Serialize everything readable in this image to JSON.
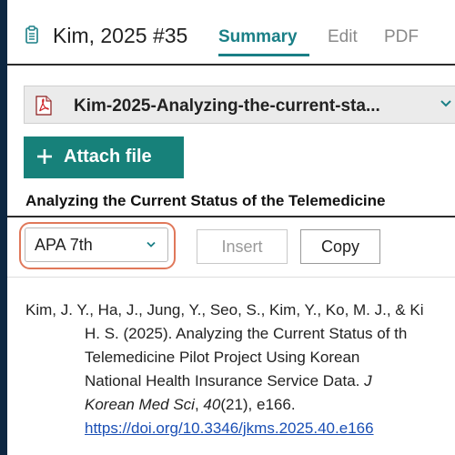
{
  "header": {
    "title": "Kim, 2025 #35",
    "tabs": [
      {
        "label": "Summary",
        "active": true
      },
      {
        "label": "Edit",
        "active": false
      },
      {
        "label": "PDF",
        "active": false
      }
    ],
    "icon": "document-list-icon"
  },
  "attachment": {
    "filename": "Kim-2025-Analyzing-the-current-sta...",
    "icon": "pdf-file-icon"
  },
  "attach_button": {
    "label": "Attach file",
    "icon": "plus-icon"
  },
  "paper_title": "Analyzing the Current Status of the Telemedicine",
  "citation_toolbar": {
    "style_selected": "APA 7th",
    "insert_label": "Insert",
    "copy_label": "Copy"
  },
  "citation": {
    "line1": "Kim, J. Y., Ha, J., Jung, Y., Seo, S., Kim, Y., Ko, M. J., & Ki",
    "line2": "H. S. (2025). Analyzing the Current Status of th",
    "line3": "Telemedicine Pilot Project Using Korean",
    "line4_a": "National Health Insurance Service Data. ",
    "line4_b": "J",
    "line5_a": "Korean Med Sci",
    "line5_b": ", ",
    "line5_c": "40",
    "line5_d": "(21), e166.",
    "doi": "https://doi.org/10.3346/jkms.2025.40.e166"
  },
  "colors": {
    "accent": "#1a7f86",
    "button": "#17817a",
    "highlight_ring": "#e0785a",
    "link": "#1a4fb5",
    "frame": "#0d2742"
  }
}
